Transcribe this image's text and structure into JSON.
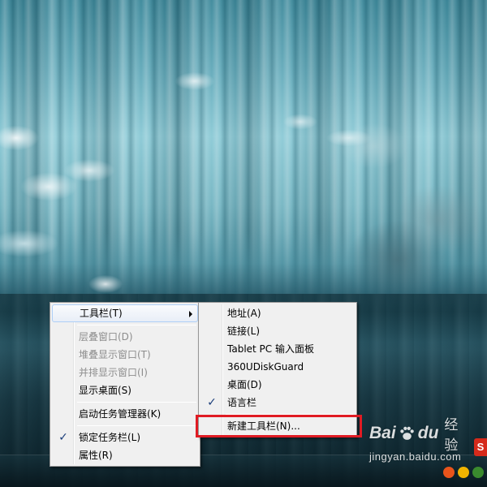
{
  "main_menu": {
    "items": [
      {
        "label": "工具栏(T)",
        "state": "highlighted",
        "has_submenu": true
      },
      {
        "type": "separator"
      },
      {
        "label": "层叠窗口(D)",
        "state": "disabled"
      },
      {
        "label": "堆叠显示窗口(T)",
        "state": "disabled"
      },
      {
        "label": "并排显示窗口(I)",
        "state": "disabled"
      },
      {
        "label": "显示桌面(S)",
        "state": "normal"
      },
      {
        "type": "separator"
      },
      {
        "label": "启动任务管理器(K)",
        "state": "normal"
      },
      {
        "type": "separator"
      },
      {
        "label": "锁定任务栏(L)",
        "state": "checked"
      },
      {
        "label": "属性(R)",
        "state": "normal"
      }
    ]
  },
  "toolbar_submenu": {
    "items": [
      {
        "label": "地址(A)",
        "checked": false
      },
      {
        "label": "链接(L)",
        "checked": false
      },
      {
        "label": "Tablet PC 输入面板",
        "checked": false
      },
      {
        "label": "360UDiskGuard",
        "checked": false
      },
      {
        "label": "桌面(D)",
        "checked": false
      },
      {
        "label": "语言栏",
        "checked": true
      },
      {
        "type": "separator"
      },
      {
        "label": "新建工具栏(N)...",
        "checked": false,
        "annotated": true
      }
    ]
  },
  "check_glyph": "✓",
  "annotation": {
    "color": "#e01b23",
    "target": "新建工具栏(N)..."
  },
  "watermark": {
    "brand_left": "Bai",
    "brand_right": "du",
    "brand_cn": "经验",
    "url": "jingyan.baidu.com"
  },
  "tray": {
    "sogou_label": "S",
    "icons": [
      "sogou-input-icon",
      "network-icon",
      "speaker-icon",
      "flag-icon"
    ]
  }
}
